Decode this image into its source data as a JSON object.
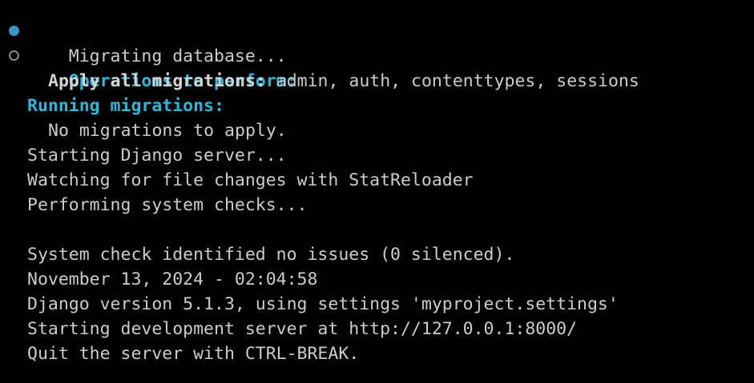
{
  "terminal": {
    "colors": {
      "background": "#000000",
      "text": "#cccccc",
      "heading": "#29b8db",
      "marker_success": "#3a94c5",
      "marker_pending": "#8b8b8b"
    },
    "lines": {
      "migrating": "Migrating database...",
      "operations_heading": "Operations to perform:",
      "apply_label": "Apply all migrations:",
      "apply_value": " admin, auth, contenttypes, sessions",
      "running_heading": "Running migrations:",
      "no_migrations": "No migrations to apply.",
      "starting_django": "Starting Django server...",
      "watching": "Watching for file changes with StatReloader",
      "performing_checks": "Performing system checks...",
      "system_check": "System check identified no issues (0 silenced).",
      "timestamp": "November 13, 2024 - 02:04:58",
      "django_version": "Django version 5.1.3, using settings 'myproject.settings'",
      "dev_server": "Starting development server at http://127.0.0.1:8000/",
      "quit": "Quit the server with CTRL-BREAK."
    }
  }
}
